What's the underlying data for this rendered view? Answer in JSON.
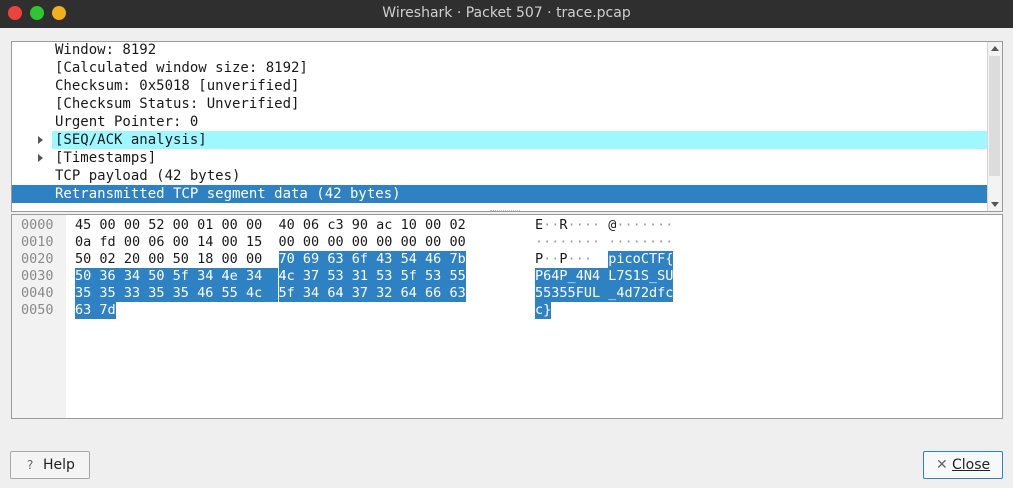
{
  "window": {
    "title": "Wireshark · Packet 507 · trace.pcap"
  },
  "colors": {
    "selection": "#2e82c4",
    "highlight": "#9ff8ff",
    "titlebar": "#2f2f2f"
  },
  "tree": [
    {
      "text": "Window: 8192",
      "expandable": false,
      "style": "normal"
    },
    {
      "text": "[Calculated window size: 8192]",
      "expandable": false,
      "style": "normal"
    },
    {
      "text": "Checksum: 0x5018 [unverified]",
      "expandable": false,
      "style": "normal"
    },
    {
      "text": "[Checksum Status: Unverified]",
      "expandable": false,
      "style": "normal"
    },
    {
      "text": "Urgent Pointer: 0",
      "expandable": false,
      "style": "normal"
    },
    {
      "text": "[SEQ/ACK analysis]",
      "expandable": true,
      "style": "cyan"
    },
    {
      "text": "[Timestamps]",
      "expandable": true,
      "style": "normal"
    },
    {
      "text": "TCP payload (42 bytes)",
      "expandable": false,
      "style": "normal"
    },
    {
      "text": "Retransmitted TCP segment data (42 bytes)",
      "expandable": false,
      "style": "selected"
    }
  ],
  "hex": {
    "rows": [
      {
        "offset": "0000",
        "bytes": "45 00 00 52 00 01 00 00  40 06 c3 90 ac 10 00 02",
        "ascii": "E··R···· @·······"
      },
      {
        "offset": "0010",
        "bytes": "0a fd 00 06 00 14 00 15  00 00 00 00 00 00 00 00",
        "ascii": "········ ········"
      },
      {
        "offset": "0020",
        "bytes": "50 02 20 00 50 18 00 00  70 69 63 6f 43 54 46 7b",
        "ascii": "P· ·P··· picoCTF{"
      },
      {
        "offset": "0030",
        "bytes": "50 36 34 50 5f 34 4e 34  4c 37 53 31 53 5f 53 55",
        "ascii": "P64P_4N4 L7S1S_SU"
      },
      {
        "offset": "0040",
        "bytes": "35 35 33 35 35 46 55 4c  5f 34 64 37 32 64 66 63",
        "ascii": "55355FUL _4d72dfc"
      },
      {
        "offset": "0050",
        "bytes": "63 7d",
        "ascii": "c}"
      }
    ],
    "highlight_start": 40,
    "highlight_length": 42
  },
  "buttons": {
    "help": "Help",
    "close": "Close"
  },
  "icons": {
    "help": "question-mark-icon",
    "close": "close-x-icon"
  }
}
